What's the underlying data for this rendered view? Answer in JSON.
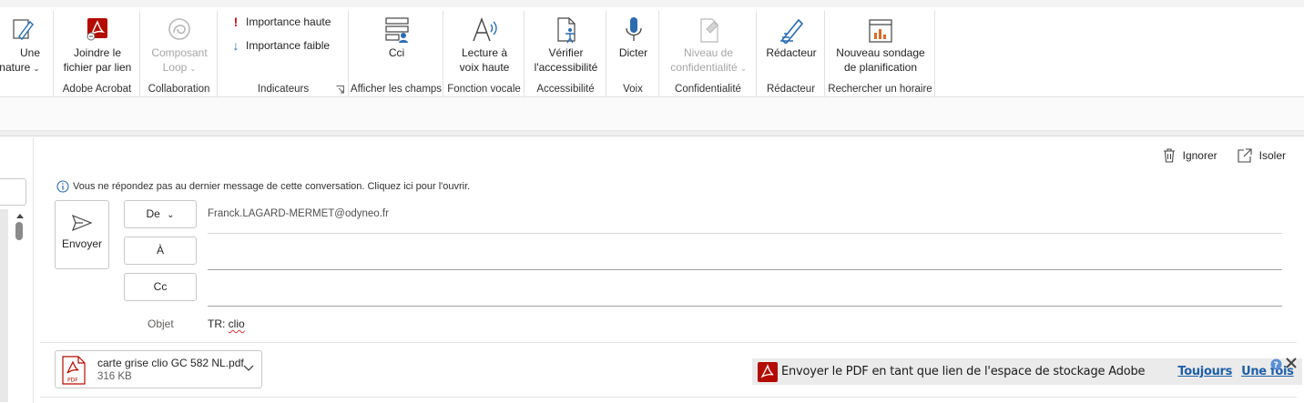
{
  "ribbon": {
    "signature": {
      "label_line1": "Une",
      "label_line2": "gnature",
      "icon": "signature-pen-icon"
    },
    "adobe_group": {
      "label": "Adobe Acrobat",
      "attach_line1": "Joindre le",
      "attach_line2": "fichier par lien"
    },
    "collab_group": {
      "label": "Collaboration",
      "loop_line1": "Composant",
      "loop_line2": "Loop"
    },
    "indicators_group": {
      "label": "Indicateurs",
      "high": "Importance haute",
      "low": "Importance faible"
    },
    "cci_group": {
      "label": "Afficher les champs",
      "cci": "Cci"
    },
    "voice_read_group": {
      "label": "Fonction vocale",
      "read_line1": "Lecture à",
      "read_line2": "voix haute"
    },
    "access_group": {
      "label": "Accessibilité",
      "check_line1": "Vérifier",
      "check_line2": "l'accessibilité"
    },
    "voice_group": {
      "label": "Voix",
      "dictate": "Dicter"
    },
    "conf_group": {
      "label": "Confidentialité",
      "level_line1": "Niveau de",
      "level_line2": "confidentialité"
    },
    "editor_group": {
      "label": "Rédacteur",
      "editor": "Rédacteur"
    },
    "schedule_group": {
      "label": "Rechercher un horaire",
      "poll_line1": "Nouveau sondage",
      "poll_line2": "de planification"
    }
  },
  "compose": {
    "discard": "Ignorer",
    "popout": "Isoler",
    "info": "Vous ne répondez pas au dernier message de cette conversation. Cliquez ici pour l'ouvrir.",
    "send": "Envoyer",
    "from_button": "De",
    "to_button": "À",
    "cc_button": "Cc",
    "from_value": "Franck.LAGARD-MERMET@odyneo.fr",
    "subject_label": "Objet",
    "subject_prefix": "TR: ",
    "subject_word": "clio"
  },
  "attachment": {
    "name": "carte grise clio GC 582 NL.pdf",
    "size": "316 KB"
  },
  "adobe_bar": {
    "message": "Envoyer le PDF en tant que lien de l'espace de stockage Adobe",
    "always": "Toujours",
    "once": "Une fois"
  },
  "colors": {
    "adobe_red": "#b30b00",
    "link_blue": "#1f5fa8",
    "icon_blue": "#2b6cb0"
  }
}
